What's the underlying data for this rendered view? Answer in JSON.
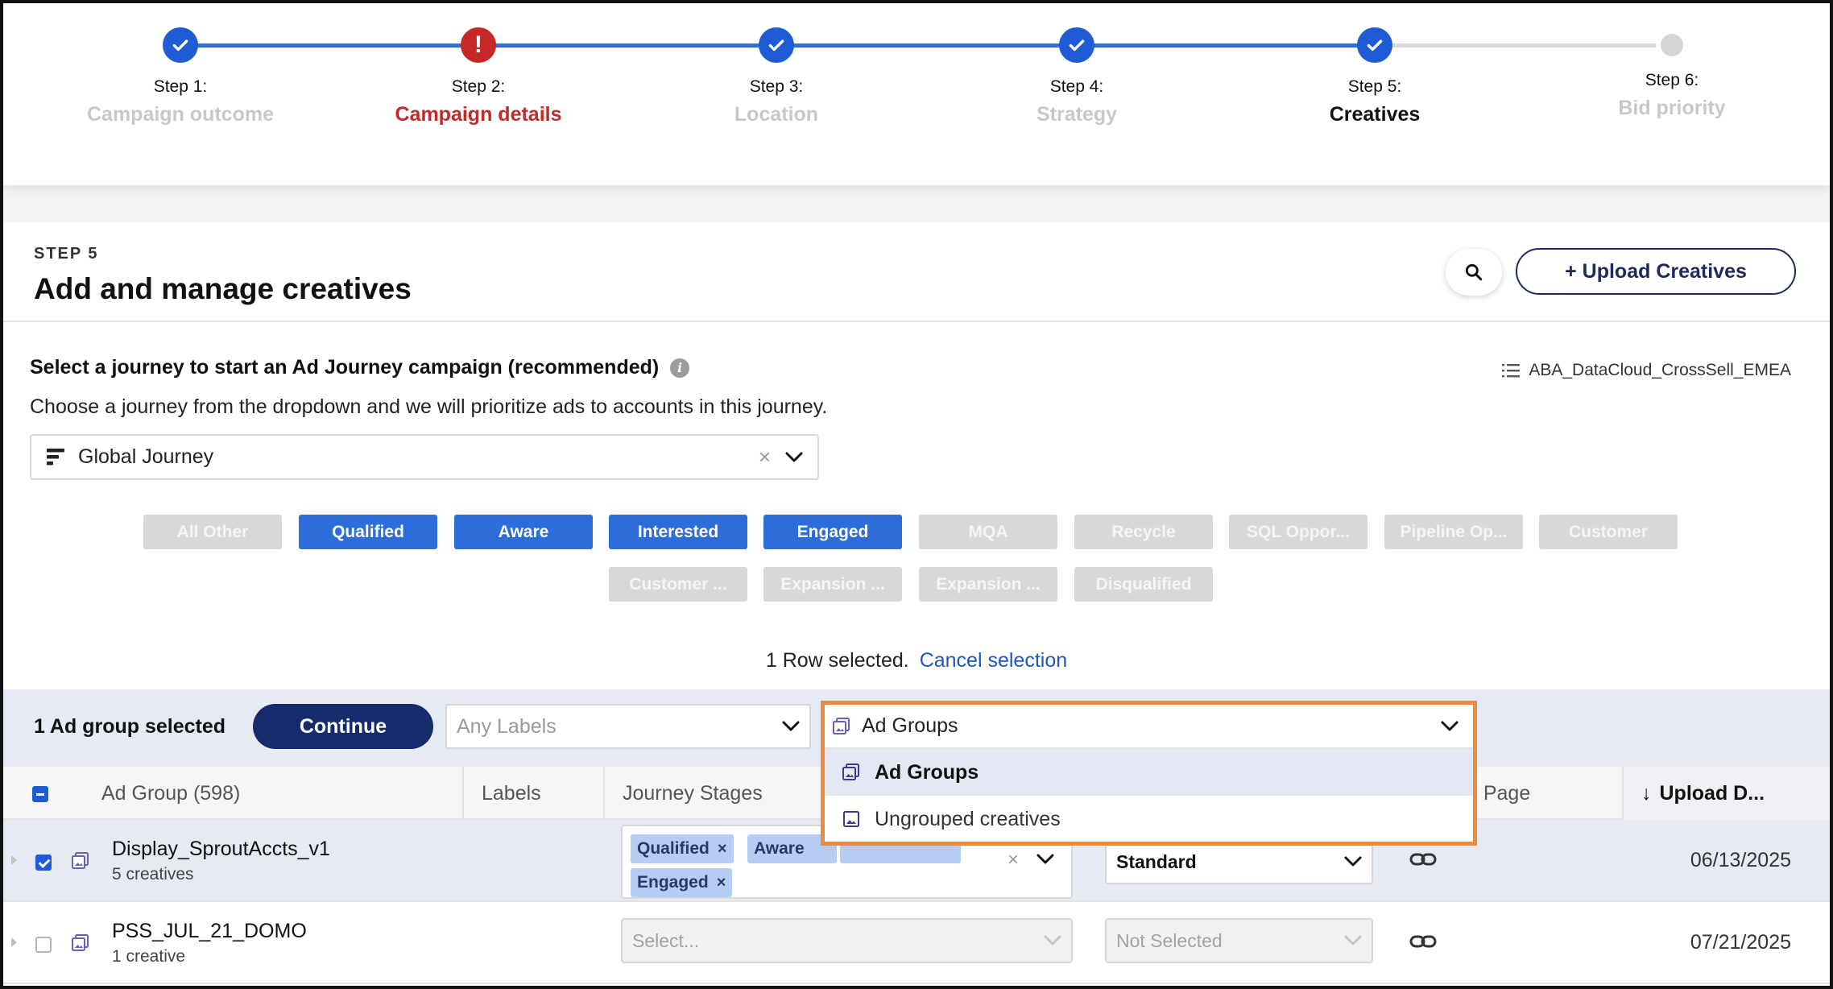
{
  "stepper": {
    "steps": [
      {
        "num": "Step 1:",
        "name": "Campaign outcome",
        "status": "done"
      },
      {
        "num": "Step 2:",
        "name": "Campaign details",
        "status": "error"
      },
      {
        "num": "Step 3:",
        "name": "Location",
        "status": "done"
      },
      {
        "num": "Step 4:",
        "name": "Strategy",
        "status": "done"
      },
      {
        "num": "Step 5:",
        "name": "Creatives",
        "status": "current"
      },
      {
        "num": "Step 6:",
        "name": "Bid priority",
        "status": "future"
      }
    ],
    "error_glyph": "!"
  },
  "header": {
    "step_label": "STEP 5",
    "title": "Add and manage creatives",
    "upload_label": "+ Upload Creatives"
  },
  "journey": {
    "heading": "Select a journey to start an Ad Journey campaign (recommended)",
    "info_glyph": "i",
    "description": "Choose a journey from the dropdown and we will prioritize ads to accounts in this journey.",
    "selected": "Global Journey",
    "clear_glyph": "×",
    "journey_name": "ABA_DataCloud_CrossSell_EMEA",
    "stages_row1": [
      {
        "label": "All Other",
        "active": false
      },
      {
        "label": "Qualified",
        "active": true
      },
      {
        "label": "Aware",
        "active": true
      },
      {
        "label": "Interested",
        "active": true
      },
      {
        "label": "Engaged",
        "active": true
      },
      {
        "label": "MQA",
        "active": false
      },
      {
        "label": "Recycle",
        "active": false
      },
      {
        "label": "SQL Oppor...",
        "active": false
      },
      {
        "label": "Pipeline Op...",
        "active": false
      },
      {
        "label": "Customer",
        "active": false
      }
    ],
    "stages_row2": [
      {
        "label": "Customer ...",
        "active": false
      },
      {
        "label": "Expansion ...",
        "active": false
      },
      {
        "label": "Expansion ...",
        "active": false
      },
      {
        "label": "Disqualified",
        "active": false
      }
    ]
  },
  "selection": {
    "text": "1 Row selected.",
    "cancel": "Cancel selection"
  },
  "toolbar": {
    "selected_count": "1 Ad group selected",
    "continue_label": "Continue",
    "labels_placeholder": "Any Labels",
    "group_by_value": "Ad Groups",
    "group_by_options": [
      {
        "label": "Ad Groups",
        "selected": true
      },
      {
        "label": "Ungrouped creatives",
        "selected": false
      }
    ]
  },
  "table": {
    "headers": {
      "ad_group": "Ad Group (598)",
      "labels": "Labels",
      "journey_stages": "Journey Stages",
      "landing_page": "g Page",
      "upload_date": "Upload D..."
    },
    "sort_glyph": "↓",
    "rows": [
      {
        "name": "Display_SproutAccts_v1",
        "sub": "5 creatives",
        "selected": true,
        "stages": [
          "Qualified",
          "Aware",
          "Engaged"
        ],
        "chip_remove": "×",
        "stage_clear": "×",
        "bid": "Standard",
        "date": "06/13/2025"
      },
      {
        "name": "PSS_JUL_21_DOMO",
        "sub": "1 creative",
        "selected": false,
        "stage_placeholder": "Select...",
        "bid": "Not Selected",
        "date": "07/21/2025"
      }
    ]
  },
  "colors": {
    "primary": "#1e5bd4",
    "error": "#c62828",
    "navy": "#162b6b",
    "highlight": "#ef8a3c"
  }
}
